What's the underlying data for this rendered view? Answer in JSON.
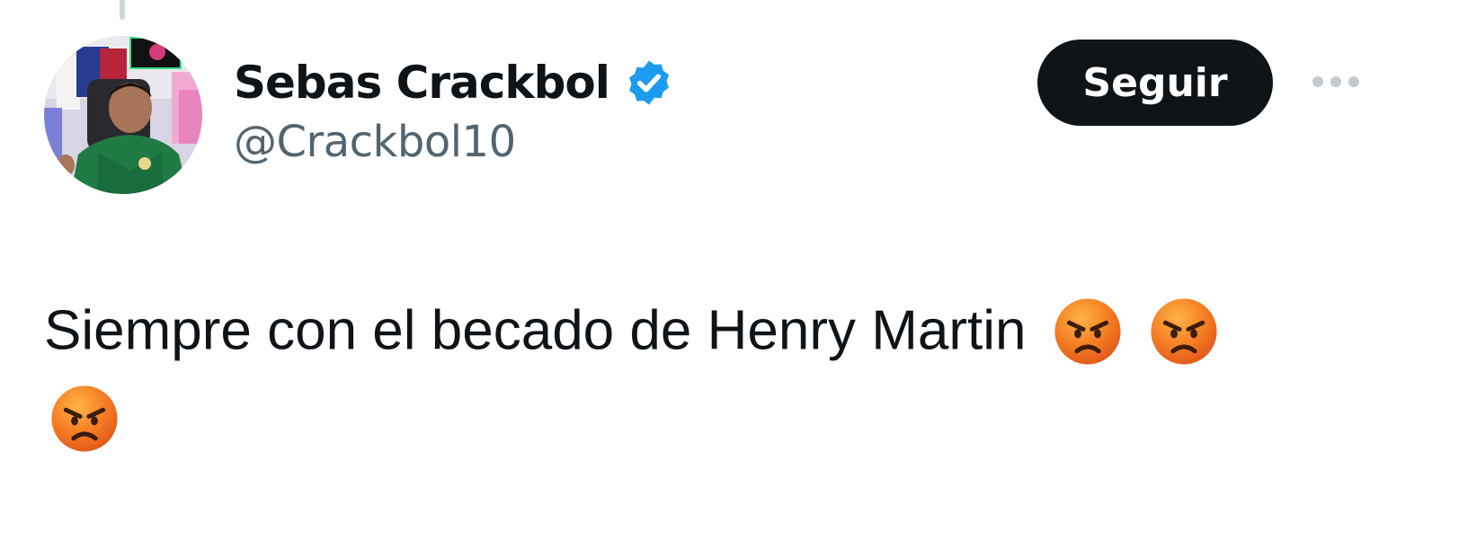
{
  "tweet": {
    "author": {
      "display_name": "Sebas Crackbol",
      "handle": "@Crackbol10",
      "verified": true,
      "avatar_icon": "avatar-photo"
    },
    "follow_label": "Seguir",
    "more_icon": "more-dots-icon",
    "text": "Siempre con el becado de Henry Martin",
    "emojis": [
      "angry-face",
      "angry-face",
      "angry-face"
    ]
  },
  "colors": {
    "text_primary": "#0f1419",
    "text_secondary": "#536471",
    "verified_blue": "#1d9bf0",
    "button_bg": "#0f1419",
    "button_text": "#ffffff"
  }
}
